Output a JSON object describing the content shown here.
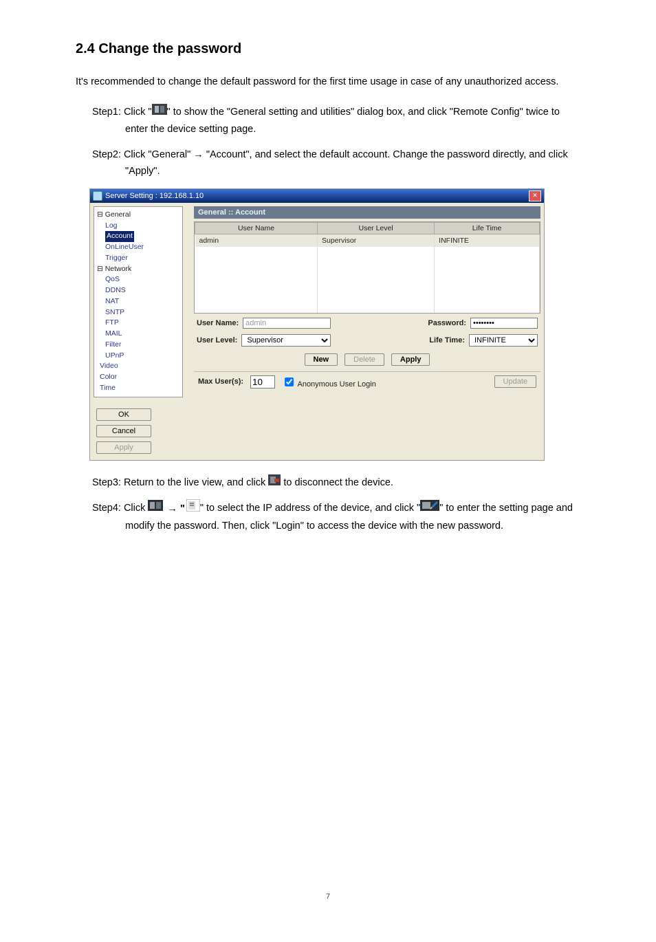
{
  "section_heading": "2.4 Change the password",
  "intro": "It's recommended to change the default password for the first time usage in case of any unauthorized access.",
  "step1_label": "Step1:",
  "step1_a": "Click \"",
  "step1_b": "\" to show the \"General setting and utilities\" dialog box, and click \"Remote Config\" twice to enter the device setting page.",
  "step2_label": "Step2:",
  "step2_text": "Click \"General\" → \"Account\", and select the default account. Change the password directly, and click \"Apply\".",
  "step3_label": "Step3:",
  "step3_a": "Return to the live view, and click ",
  "step3_b": " to disconnect the device.",
  "step4_label": "Step4:",
  "step4_a": "Click ",
  "step4_b": " → \"",
  "step4_c": "\" to select the IP address of the device, and click \"",
  "step4_d": "\" to enter the setting page and modify the password. Then, click \"Login\" to access the device with the new password.",
  "dialog": {
    "title": "Server Setting : 192.168.1.10",
    "breadcrumb": "General :: Account",
    "tree": {
      "general": "General",
      "items1": [
        "Log",
        "Account",
        "OnLineUser",
        "Trigger"
      ],
      "network": "Network",
      "items2": [
        "QoS",
        "DDNS",
        "NAT",
        "SNTP",
        "FTP",
        "MAIL",
        "Filter",
        "UPnP"
      ],
      "rest": [
        "Video",
        "Color",
        "Time"
      ]
    },
    "table": {
      "headers": [
        "User Name",
        "User Level",
        "Life Time"
      ],
      "row": [
        "admin",
        "Supervisor",
        "INFINITE"
      ]
    },
    "form": {
      "username_label": "User Name:",
      "username_value": "admin",
      "password_label": "Password:",
      "password_value": "********",
      "userlevel_label": "User Level:",
      "userlevel_value": "Supervisor",
      "lifetime_label": "Life Time:",
      "lifetime_value": "INFINITE"
    },
    "buttons": {
      "new": "New",
      "delete": "Delete",
      "apply": "Apply",
      "ok": "OK",
      "cancel": "Cancel",
      "apply_side": "Apply",
      "update": "Update"
    },
    "bottom": {
      "maxuser_label": "Max User(s):",
      "maxuser_value": "10",
      "anon_label": "Anonymous User Login"
    }
  },
  "page_number": "7"
}
